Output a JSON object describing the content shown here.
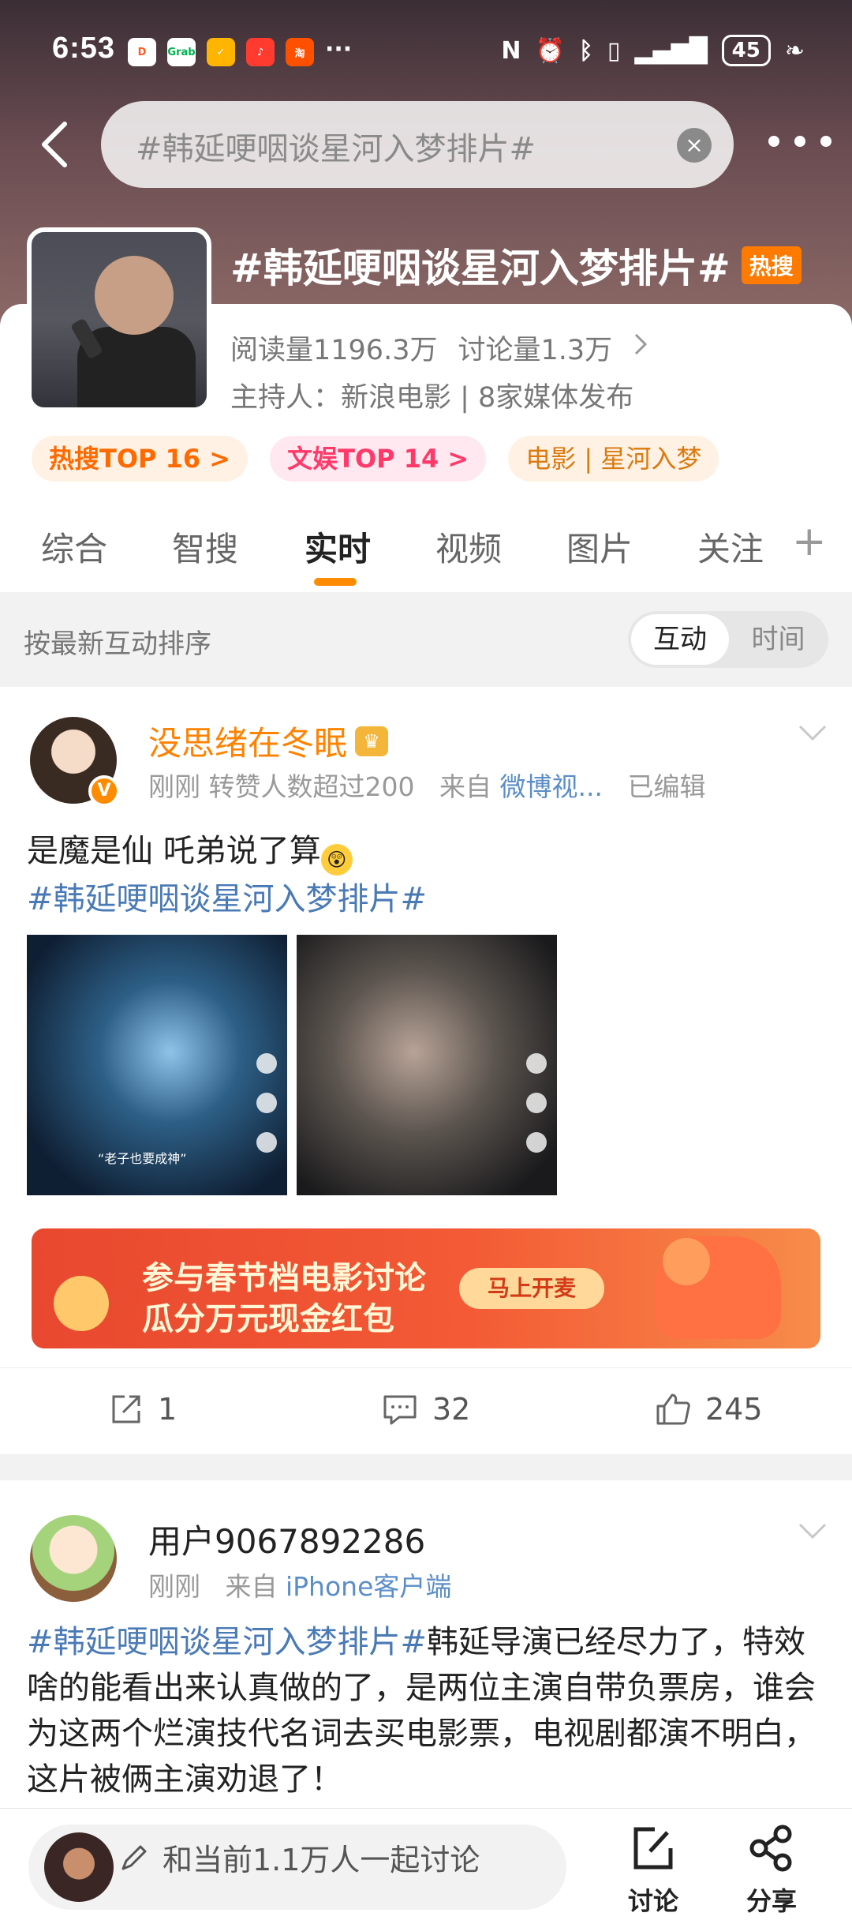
{
  "status": {
    "time": "6:53",
    "battery": "45",
    "apps": [
      "Grab",
      "淘",
      "小红书"
    ]
  },
  "search": {
    "query": "#韩延哽咽谈星河入梦排片#"
  },
  "topic": {
    "title": "#韩延哽咽谈星河入梦排片#",
    "hot_badge": "热搜",
    "reads": "阅读量1196.3万",
    "discussions": "讨论量1.3万",
    "host": "主持人：新浪电影 | 8家媒体发布",
    "pills": [
      "热搜TOP 16 >",
      "文娱TOP 14 >",
      "电影 | 星河入梦"
    ]
  },
  "tabs": [
    "综合",
    "智搜",
    "实时",
    "视频",
    "图片",
    "关注"
  ],
  "active_tab": "实时",
  "sort": {
    "label": "按最新互动排序",
    "options": [
      "互动",
      "时间"
    ],
    "selected": "互动"
  },
  "posts": [
    {
      "author": "没思绪在冬眠",
      "meta_time": "刚刚",
      "meta_reposts": "转赞人数超过200",
      "meta_from": "来自",
      "meta_source": "微博视...",
      "meta_edited": "已编辑",
      "text_line1": "是魔是仙 吒弟说了算",
      "hashtag": "#韩延哽咽谈星河入梦排片#",
      "image1_caption": "“老子也要成神”",
      "banner_line1": "参与春节档电影讨论",
      "banner_line2": "瓜分万元现金红包",
      "banner_button": "马上开麦",
      "reposts": "1",
      "comments": "32",
      "likes": "245"
    },
    {
      "author": "用户9067892286",
      "meta_time": "刚刚",
      "meta_from": "来自",
      "meta_source": "iPhone客户端",
      "hashtag": "#韩延哽咽谈星河入梦排片#",
      "text": "韩延导演已经尽力了，特效啥的能看出来认真做的了，是两位主演自带负票房，谁会为这两个烂演技代名词去买电影票，电视剧都演不明白，这片被俩主演劝退了！"
    }
  ],
  "bottom": {
    "placeholder": "和当前1.1万人一起讨论",
    "discuss_label": "讨论",
    "share_label": "分享"
  },
  "colors": {
    "accent": "#ff8200",
    "link": "#4a7ab5",
    "hot": "#ff7a00"
  }
}
